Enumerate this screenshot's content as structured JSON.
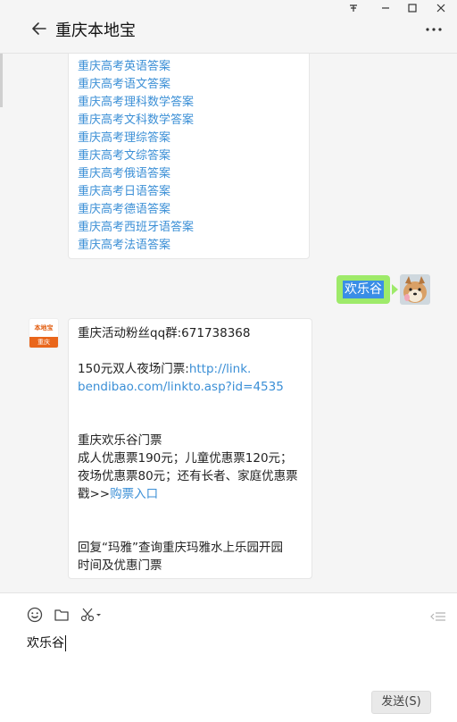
{
  "window": {
    "pin_icon": "pin-icon",
    "controls": [
      "minimize-icon",
      "maximize-icon",
      "close-icon"
    ]
  },
  "header": {
    "title": "重庆本地宝",
    "back_icon": "back-arrow-icon",
    "more_icon": "more-icon"
  },
  "messages": {
    "link_list": [
      "重庆高考英语答案",
      "重庆高考语文答案",
      "重庆高考理科数学答案",
      "重庆高考文科数学答案",
      "重庆高考理综答案",
      "重庆高考文综答案",
      "重庆高考俄语答案",
      "重庆高考日语答案",
      "重庆高考德语答案",
      "重庆高考西班牙语答案",
      "重庆高考法语答案"
    ],
    "sent": {
      "text": "欢乐谷"
    },
    "reply": {
      "avatar_top": "本地宝",
      "avatar_bottom": "重庆",
      "line1": "重庆活动粉丝qq群:671738368",
      "line2_prefix": "150元双人夜场门票:",
      "line2_link_a": "http://link.",
      "line2_link_b": "bendibao.com/linkto.asp?id=4535",
      "line3": "重庆欢乐谷门票",
      "line4": "成人优惠票190元；儿童优惠票120元；",
      "line5": "夜场优惠票80元；还有长者、家庭优惠票",
      "line6_prefix": "戳>>",
      "line6_link": "购票入口",
      "line7": "回复“玛雅”查询重庆玛雅水上乐园开园",
      "line8": "时间及优惠门票"
    }
  },
  "input": {
    "toolbar_icons": [
      "emoji-icon",
      "folder-icon",
      "scissors-icon"
    ],
    "text": "欢乐谷",
    "send_label": "发送(S)",
    "collapse_icon": "collapse-icon"
  },
  "colors": {
    "link": "#3b8fd6",
    "sent_bubble": "#9eea6a",
    "selection": "#3a8ee6",
    "brand_orange": "#e9661b"
  }
}
